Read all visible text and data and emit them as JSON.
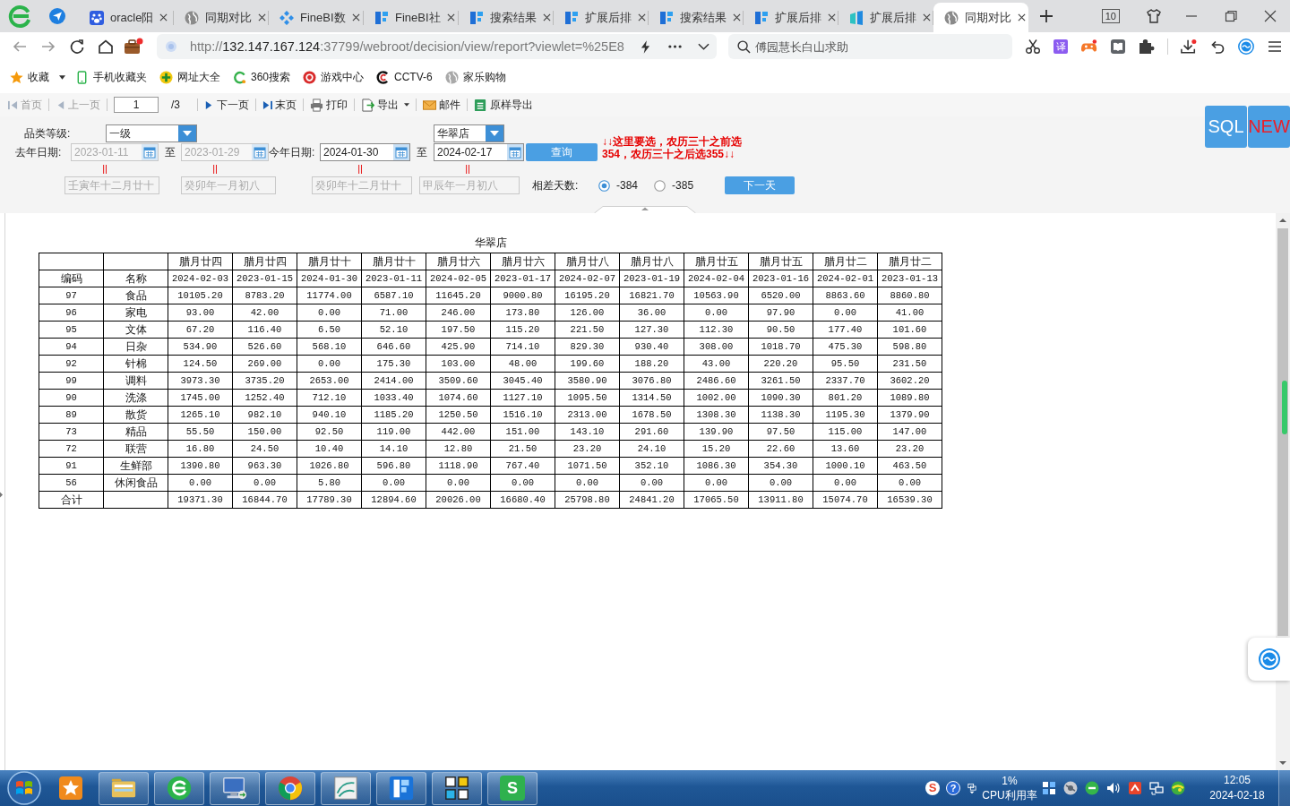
{
  "browser": {
    "tabs": [
      {
        "label": "oracle阳",
        "kind": "paw",
        "selected": false
      },
      {
        "label": "同期对比",
        "kind": "globe",
        "selected": false
      },
      {
        "label": "FineBI数",
        "kind": "diamond",
        "selected": false
      },
      {
        "label": "FineBI社",
        "kind": "logo",
        "selected": false
      },
      {
        "label": "搜索结果",
        "kind": "logo",
        "selected": false
      },
      {
        "label": "扩展后排",
        "kind": "logo",
        "selected": false
      },
      {
        "label": "搜索结果",
        "kind": "logo",
        "selected": false
      },
      {
        "label": "扩展后排",
        "kind": "logo",
        "selected": false
      },
      {
        "label": "扩展后排",
        "kind": "bars",
        "selected": false
      },
      {
        "label": "同期对比",
        "kind": "globe",
        "selected": true
      }
    ],
    "tab_count": "10",
    "url": {
      "scheme": "http://",
      "host": "132.147.167.124",
      "path": ":37799/webroot/decision/view/report?viewlet=%25E8"
    },
    "search": {
      "placeholder": "傅园慧长白山求助"
    },
    "translate_glyph": "译",
    "bookmarks": [
      {
        "label": "收藏",
        "kind": "star"
      },
      {
        "label": "手机收藏夹",
        "kind": "phone"
      },
      {
        "label": "网址大全",
        "kind": "plus"
      },
      {
        "label": "360搜索",
        "kind": "ring"
      },
      {
        "label": "游戏中心",
        "kind": "game"
      },
      {
        "label": "CCTV-6",
        "kind": "arc"
      },
      {
        "label": "家乐购物",
        "kind": "globe"
      }
    ]
  },
  "report_toolbar": {
    "items": [
      {
        "kind": "first",
        "label": "首页",
        "disabled": true,
        "dropdown": false
      },
      {
        "kind": "prev",
        "label": "上一页",
        "disabled": true,
        "dropdown": false
      },
      {
        "kind": "page",
        "value": "1",
        "total": "/3",
        "disabled": false
      },
      {
        "kind": "next",
        "label": "下一页",
        "disabled": false,
        "dropdown": false
      },
      {
        "kind": "last",
        "label": "末页",
        "disabled": false,
        "dropdown": false
      },
      {
        "kind": "print",
        "label": "打印",
        "disabled": false,
        "dropdown": false
      },
      {
        "kind": "export",
        "label": "导出",
        "disabled": false,
        "dropdown": true
      },
      {
        "kind": "mail",
        "label": "邮件",
        "disabled": false,
        "dropdown": false
      },
      {
        "kind": "excel",
        "label": "原样导出",
        "disabled": false,
        "dropdown": false
      }
    ]
  },
  "parameters": {
    "category": {
      "label": "品类等级:",
      "value": "一级"
    },
    "store": {
      "value": "华翠店"
    },
    "last_year": {
      "label": "去年日期:",
      "separator": "至",
      "from": {
        "value": "2023-01-11",
        "disabled": true
      },
      "to": {
        "value": "2023-01-29",
        "disabled": true
      }
    },
    "this_year": {
      "label": "今年日期:",
      "separator": "至",
      "from": {
        "value": "2024-01-30",
        "disabled": false
      },
      "to": {
        "value": "2024-02-17",
        "disabled": false
      }
    },
    "query_button": {
      "label": "查询"
    },
    "note_lines": [
      "↓↓这里要选，农历三十之前选",
      "354，农历三十之后选355↓↓"
    ],
    "markers": [
      "||",
      "||",
      "||",
      "||"
    ],
    "lunar_dates": [
      {
        "value": "壬寅年十二月廿十",
        "disabled": true
      },
      {
        "value": "癸卯年一月初八",
        "disabled": true
      },
      {
        "value": "癸卯年十二月廿十",
        "disabled": true
      },
      {
        "value": "甲辰年一月初八",
        "disabled": true
      }
    ],
    "day_diff": {
      "label": "相差天数:",
      "options": [
        {
          "label": "-384",
          "selected": true
        },
        {
          "label": "-385",
          "selected": false
        }
      ]
    },
    "next_day_button": {
      "label": "下一天"
    }
  },
  "logo": {
    "left": "SQL",
    "right": "NEW"
  },
  "report": {
    "title": "华翠店",
    "code_header": "编码",
    "name_header": "名称",
    "columns": [
      {
        "lunar": "腊月廿四",
        "date": "2024-02-03"
      },
      {
        "lunar": "腊月廿四",
        "date": "2023-01-15"
      },
      {
        "lunar": "腊月廿十",
        "date": "2024-01-30"
      },
      {
        "lunar": "腊月廿十",
        "date": "2023-01-11"
      },
      {
        "lunar": "腊月廿六",
        "date": "2024-02-05"
      },
      {
        "lunar": "腊月廿六",
        "date": "2023-01-17"
      },
      {
        "lunar": "腊月廿八",
        "date": "2024-02-07"
      },
      {
        "lunar": "腊月廿八",
        "date": "2023-01-19"
      },
      {
        "lunar": "腊月廿五",
        "date": "2024-02-04"
      },
      {
        "lunar": "腊月廿五",
        "date": "2023-01-16"
      },
      {
        "lunar": "腊月廿二",
        "date": "2024-02-01"
      },
      {
        "lunar": "腊月廿二",
        "date": "2023-01-13"
      }
    ],
    "rows": [
      {
        "code": "97",
        "name": "食品",
        "values": [
          "10105.20",
          "8783.20",
          "11774.00",
          "6587.10",
          "11645.20",
          "9000.80",
          "16195.20",
          "16821.70",
          "10563.90",
          "6520.00",
          "8863.60",
          "8860.80"
        ]
      },
      {
        "code": "96",
        "name": "家电",
        "values": [
          "93.00",
          "42.00",
          "0.00",
          "71.00",
          "246.00",
          "173.80",
          "126.00",
          "36.00",
          "0.00",
          "97.90",
          "0.00",
          "41.00"
        ]
      },
      {
        "code": "95",
        "name": "文体",
        "values": [
          "67.20",
          "116.40",
          "6.50",
          "52.10",
          "197.50",
          "115.20",
          "221.50",
          "127.30",
          "112.30",
          "90.50",
          "177.40",
          "101.60"
        ]
      },
      {
        "code": "94",
        "name": "日杂",
        "values": [
          "534.90",
          "526.60",
          "568.10",
          "646.60",
          "425.90",
          "714.10",
          "829.30",
          "930.40",
          "308.00",
          "1018.70",
          "475.30",
          "598.80"
        ]
      },
      {
        "code": "92",
        "name": "针棉",
        "values": [
          "124.50",
          "269.00",
          "0.00",
          "175.30",
          "103.00",
          "48.00",
          "199.60",
          "188.20",
          "43.00",
          "220.20",
          "95.50",
          "231.50"
        ]
      },
      {
        "code": "99",
        "name": "调料",
        "values": [
          "3973.30",
          "3735.20",
          "2653.00",
          "2414.00",
          "3509.60",
          "3045.40",
          "3580.90",
          "3076.80",
          "2486.60",
          "3261.50",
          "2337.70",
          "3602.20"
        ]
      },
      {
        "code": "90",
        "name": "洗涤",
        "values": [
          "1745.00",
          "1252.40",
          "712.10",
          "1033.40",
          "1074.60",
          "1127.10",
          "1095.50",
          "1314.50",
          "1002.00",
          "1090.30",
          "801.20",
          "1089.80"
        ]
      },
      {
        "code": "89",
        "name": "散货",
        "values": [
          "1265.10",
          "982.10",
          "940.10",
          "1185.20",
          "1250.50",
          "1516.10",
          "2313.00",
          "1678.50",
          "1308.30",
          "1138.30",
          "1195.30",
          "1379.90"
        ]
      },
      {
        "code": "73",
        "name": "精品",
        "values": [
          "55.50",
          "150.00",
          "92.50",
          "119.00",
          "442.00",
          "151.00",
          "143.10",
          "291.60",
          "139.90",
          "97.50",
          "115.00",
          "147.00"
        ]
      },
      {
        "code": "72",
        "name": "联营",
        "values": [
          "16.80",
          "24.50",
          "10.40",
          "14.10",
          "12.80",
          "21.50",
          "23.20",
          "24.10",
          "15.20",
          "22.60",
          "13.60",
          "23.20"
        ]
      },
      {
        "code": "91",
        "name": "生鲜部",
        "values": [
          "1390.80",
          "963.30",
          "1026.80",
          "596.80",
          "1118.90",
          "767.40",
          "1071.50",
          "352.10",
          "1086.30",
          "354.30",
          "1000.10",
          "463.50"
        ]
      },
      {
        "code": "56",
        "name": "休闲食品",
        "values": [
          "0.00",
          "0.00",
          "5.80",
          "0.00",
          "0.00",
          "0.00",
          "0.00",
          "0.00",
          "0.00",
          "0.00",
          "0.00",
          "0.00"
        ]
      }
    ],
    "total": {
      "label": "合计",
      "values": [
        "19371.30",
        "16844.70",
        "17789.30",
        "12894.60",
        "20026.00",
        "16680.40",
        "25798.80",
        "24841.20",
        "17065.50",
        "13911.80",
        "15074.70",
        "16539.30"
      ]
    }
  },
  "taskbar": {
    "sheet_glyph": "S",
    "ime_glyph": "S",
    "help_glyph": "?",
    "cpu": {
      "value": "1%",
      "label": "CPU利用率"
    },
    "clock": {
      "time": "12:05",
      "date": "2024-02-18"
    }
  }
}
